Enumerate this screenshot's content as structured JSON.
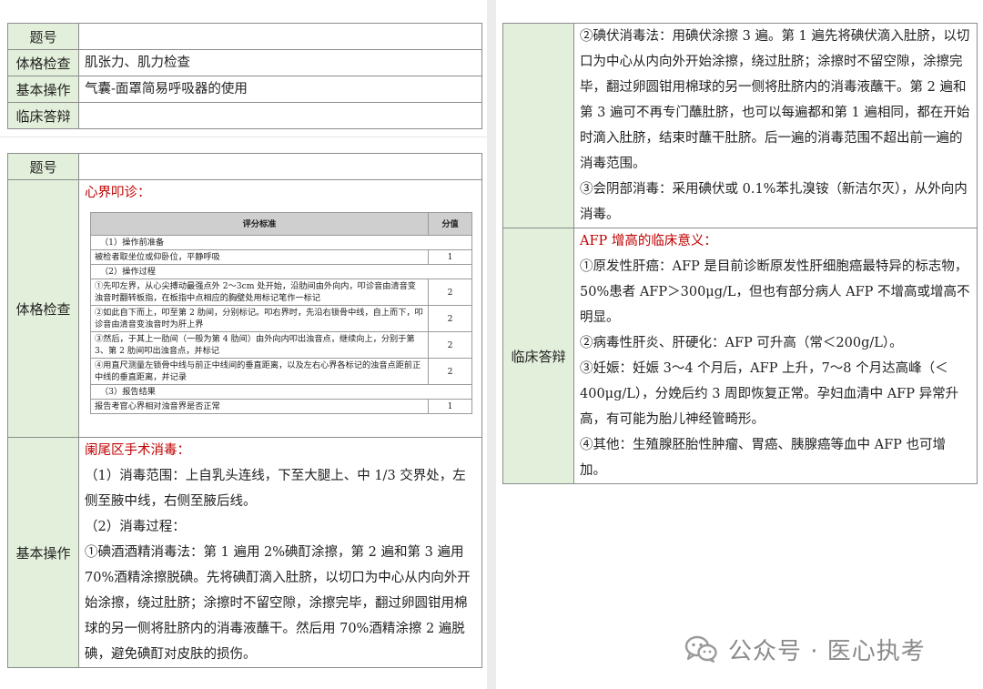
{
  "table1": {
    "rows": [
      {
        "label": "题号",
        "value": ""
      },
      {
        "label": "体格检查",
        "value": "肌张力、肌力检查"
      },
      {
        "label": "基本操作",
        "value": "气囊-面罩简易呼吸器的使用"
      },
      {
        "label": "临床答辩",
        "value": ""
      }
    ]
  },
  "table2": {
    "title_label": "题号",
    "exam_label": "体格检查",
    "exam_heading": "心界叩诊：",
    "score_table": {
      "header": [
        "评分标准",
        "分值"
      ],
      "rows": [
        {
          "text": "（1）操作前准备",
          "score": ""
        },
        {
          "text": "被检者取坐位或仰卧位，平静呼吸",
          "score": "1"
        },
        {
          "text": "（2）操作过程",
          "score": ""
        },
        {
          "text": "①先叩左界，从心尖搏动最强点外 2～3cm 处开始，沿肋间由外向内，叩诊音由清音变浊音时翻转板指，在板指中点相应的胸壁处用标记笔作一标记",
          "score": "2"
        },
        {
          "text": "②如此自下而上，叩至第 2 肋间，分别标记。叩右界时，先沿右锁骨中线，自上而下，叩诊音由清音变浊音时为肝上界",
          "score": "2"
        },
        {
          "text": "③然后，于其上一肋间（一般为第 4 肋间）由外向内叩出浊音点，继续向上，分别于第 3、第 2 肋间叩出浊音点，并标记",
          "score": "2"
        },
        {
          "text": "④用直尺测量左锁骨中线与前正中线间的垂直距离，以及左右心界各标记的浊音点距前正中线的垂直距离，并记录",
          "score": "2"
        },
        {
          "text": "（3）报告结果",
          "score": ""
        },
        {
          "text": "报告考官心界相对浊音界是否正常",
          "score": "1"
        }
      ]
    },
    "op_label": "基本操作",
    "op_heading": "阑尾区手术消毒：",
    "op_paragraphs": [
      "（1）消毒范围：上自乳头连线，下至大腿上、中 1/3 交界处，左侧至腋中线，右侧至腋后线。",
      "（2）消毒过程：",
      "①碘酒酒精消毒法：第 1 遍用 2%碘酊涂擦，第 2 遍和第 3 遍用 70%酒精涂擦脱碘。先将碘酊滴入肚脐，以切口为中心从内向外开始涂擦，绕过肚脐；涂擦时不留空隙，涂擦完毕，翻过卵圆钳用棉球的另一侧将肚脐内的消毒液蘸干。然后用 70%酒精涂擦 2 遍脱碘，避免碘酊对皮肤的损伤。"
    ]
  },
  "table3": {
    "op_paragraphs": [
      "②碘伏消毒法：用碘伏涂擦 3 遍。第 1 遍先将碘伏滴入肚脐，以切口为中心从内向外开始涂擦，绕过肚脐；涂擦时不留空隙，涂擦完毕，翻过卵圆钳用棉球的另一侧将肚脐内的消毒液蘸干。第 2 遍和第 3 遍可不再专门蘸肚脐，也可以每遍都和第 1 遍相同，都在开始时滴入肚脐，结束时蘸干肚脐。后一遍的消毒范围不超出前一遍的消毒范围。",
      "③会阴部消毒：采用碘伏或 0.1%苯扎溴铵（新洁尔灭），从外向内消毒。"
    ],
    "clinic_label": "临床答辩",
    "clinic_heading": "AFP 增高的临床意义：",
    "clinic_paragraphs": [
      "①原发性肝癌：AFP 是目前诊断原发性肝细胞癌最特异的标志物，50%患者 AFP＞300μg/L，但也有部分病人 AFP 不增高或增高不明显。",
      "②病毒性肝炎、肝硬化：AFP 可升高（常＜200g/L）。",
      "③妊娠：妊娠 3～4 个月后，AFP 上升，7～8 个月达高峰（＜400μg/L），分娩后约 3 周即恢复正常。孕妇血清中 AFP 异常升高，有可能为胎儿神经管畸形。",
      "④其他：生殖腺胚胎性肿瘤、胃癌、胰腺癌等血中 AFP 也可增加。"
    ]
  },
  "watermark": {
    "text": "公众号 · 医心执考",
    "icon": "wechat-icon"
  }
}
